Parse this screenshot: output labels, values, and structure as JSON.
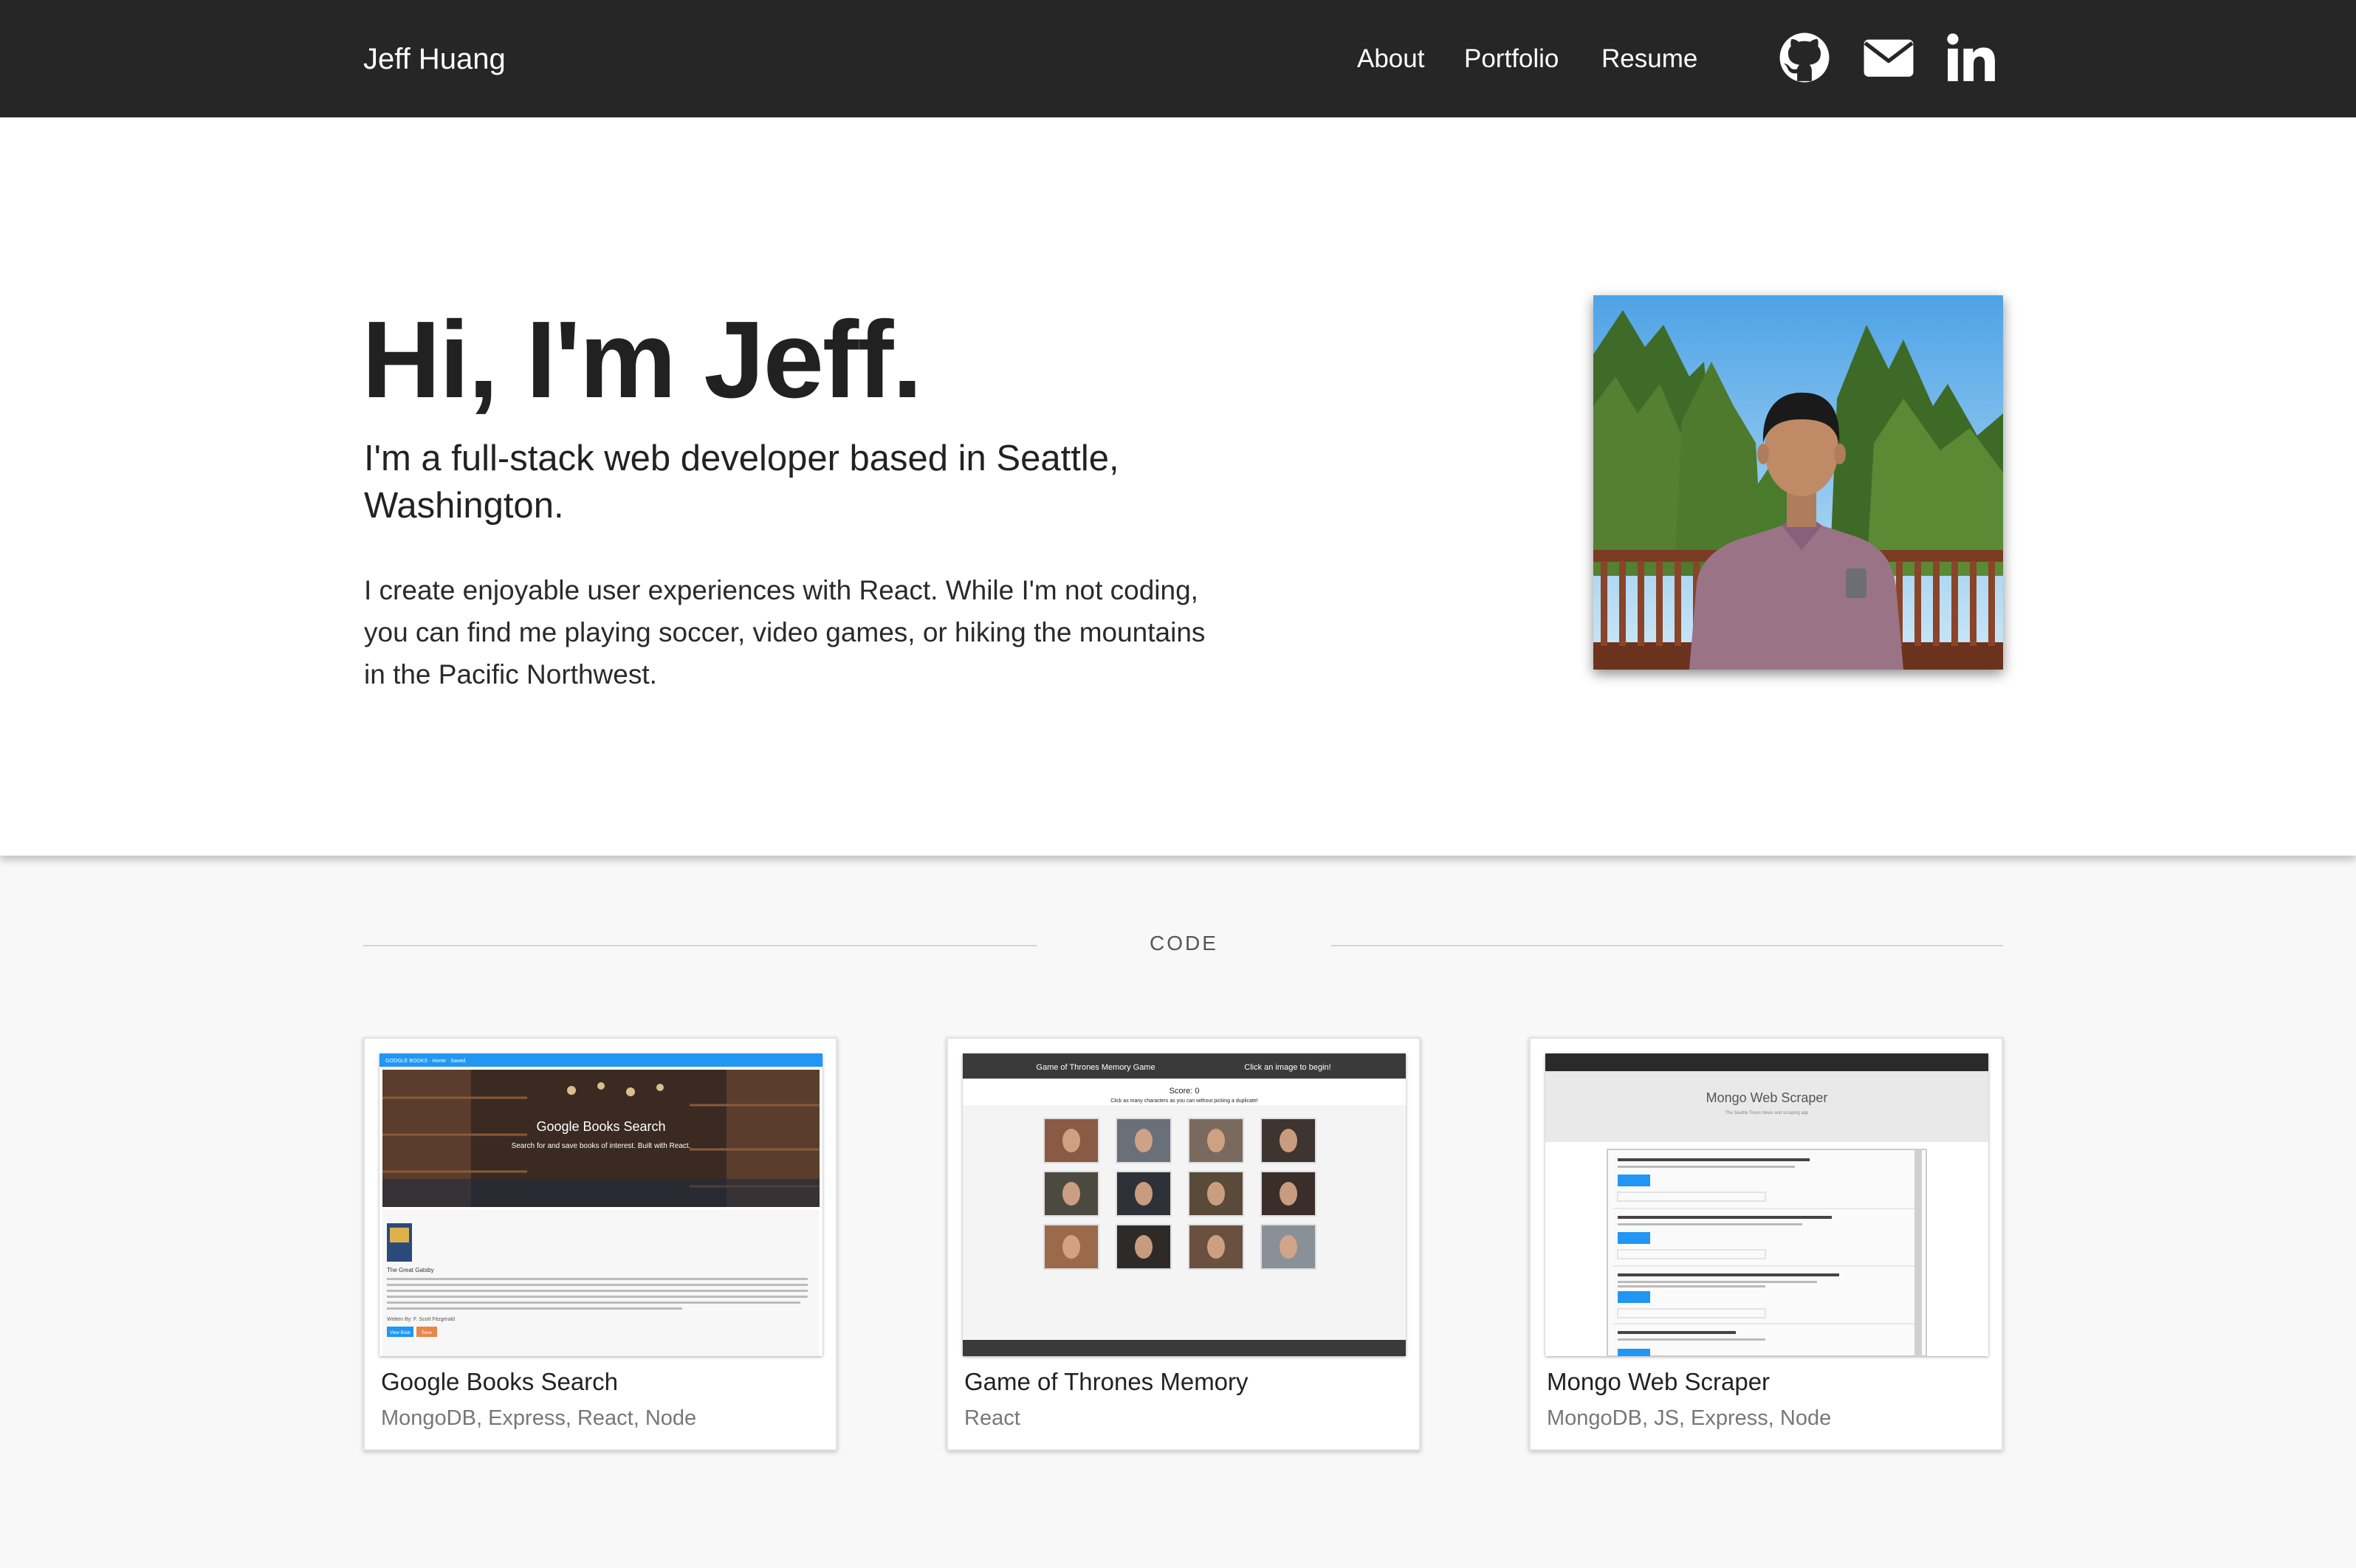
{
  "nav": {
    "brand": "Jeff Huang",
    "links": [
      "About",
      "Portfolio",
      "Resume"
    ],
    "icons": [
      "github-icon",
      "mail-icon",
      "linkedin-icon"
    ]
  },
  "hero": {
    "title": "Hi, I'm Jeff.",
    "subtitle": "I'm a full-stack web developer based in Seattle, Washington.",
    "body": "I create enjoyable user experiences with React. While I'm not coding, you can find me playing soccer, video games, or hiking the mountains in the Pacific Northwest."
  },
  "section": {
    "label": "CODE"
  },
  "projects": [
    {
      "title": "Google Books Search",
      "tags": "MongoDB, Express, React, Node",
      "thumb": {
        "nav_text": "GOOGLE BOOKS · Home · Saved",
        "hero_title": "Google Books Search",
        "hero_sub": "Search for and save books of interest. Built with React.",
        "book_title": "The Great Gatsby",
        "book_author": "Written By: F. Scott Fitzgerald",
        "btn_view": "View Book",
        "btn_save": "Save"
      }
    },
    {
      "title": "Game of Thrones Memory",
      "tags": "React",
      "thumb": {
        "header_left": "Game of Thrones Memory Game",
        "header_right": "Click an image to begin!",
        "score": "Score: 0",
        "instructions": "Click as many characters as you can without picking a duplicate!"
      }
    },
    {
      "title": "Mongo Web Scraper",
      "tags": "MongoDB, JS, Express, Node",
      "thumb": {
        "jumbo_title": "Mongo Web Scraper",
        "jumbo_sub": "The Seattle Times News and scraping app"
      }
    }
  ],
  "colors": {
    "navbar_bg": "#262626",
    "section_bg": "#f8f8f8",
    "books_accent": "#2196f3",
    "card_tag_text": "#777777"
  }
}
